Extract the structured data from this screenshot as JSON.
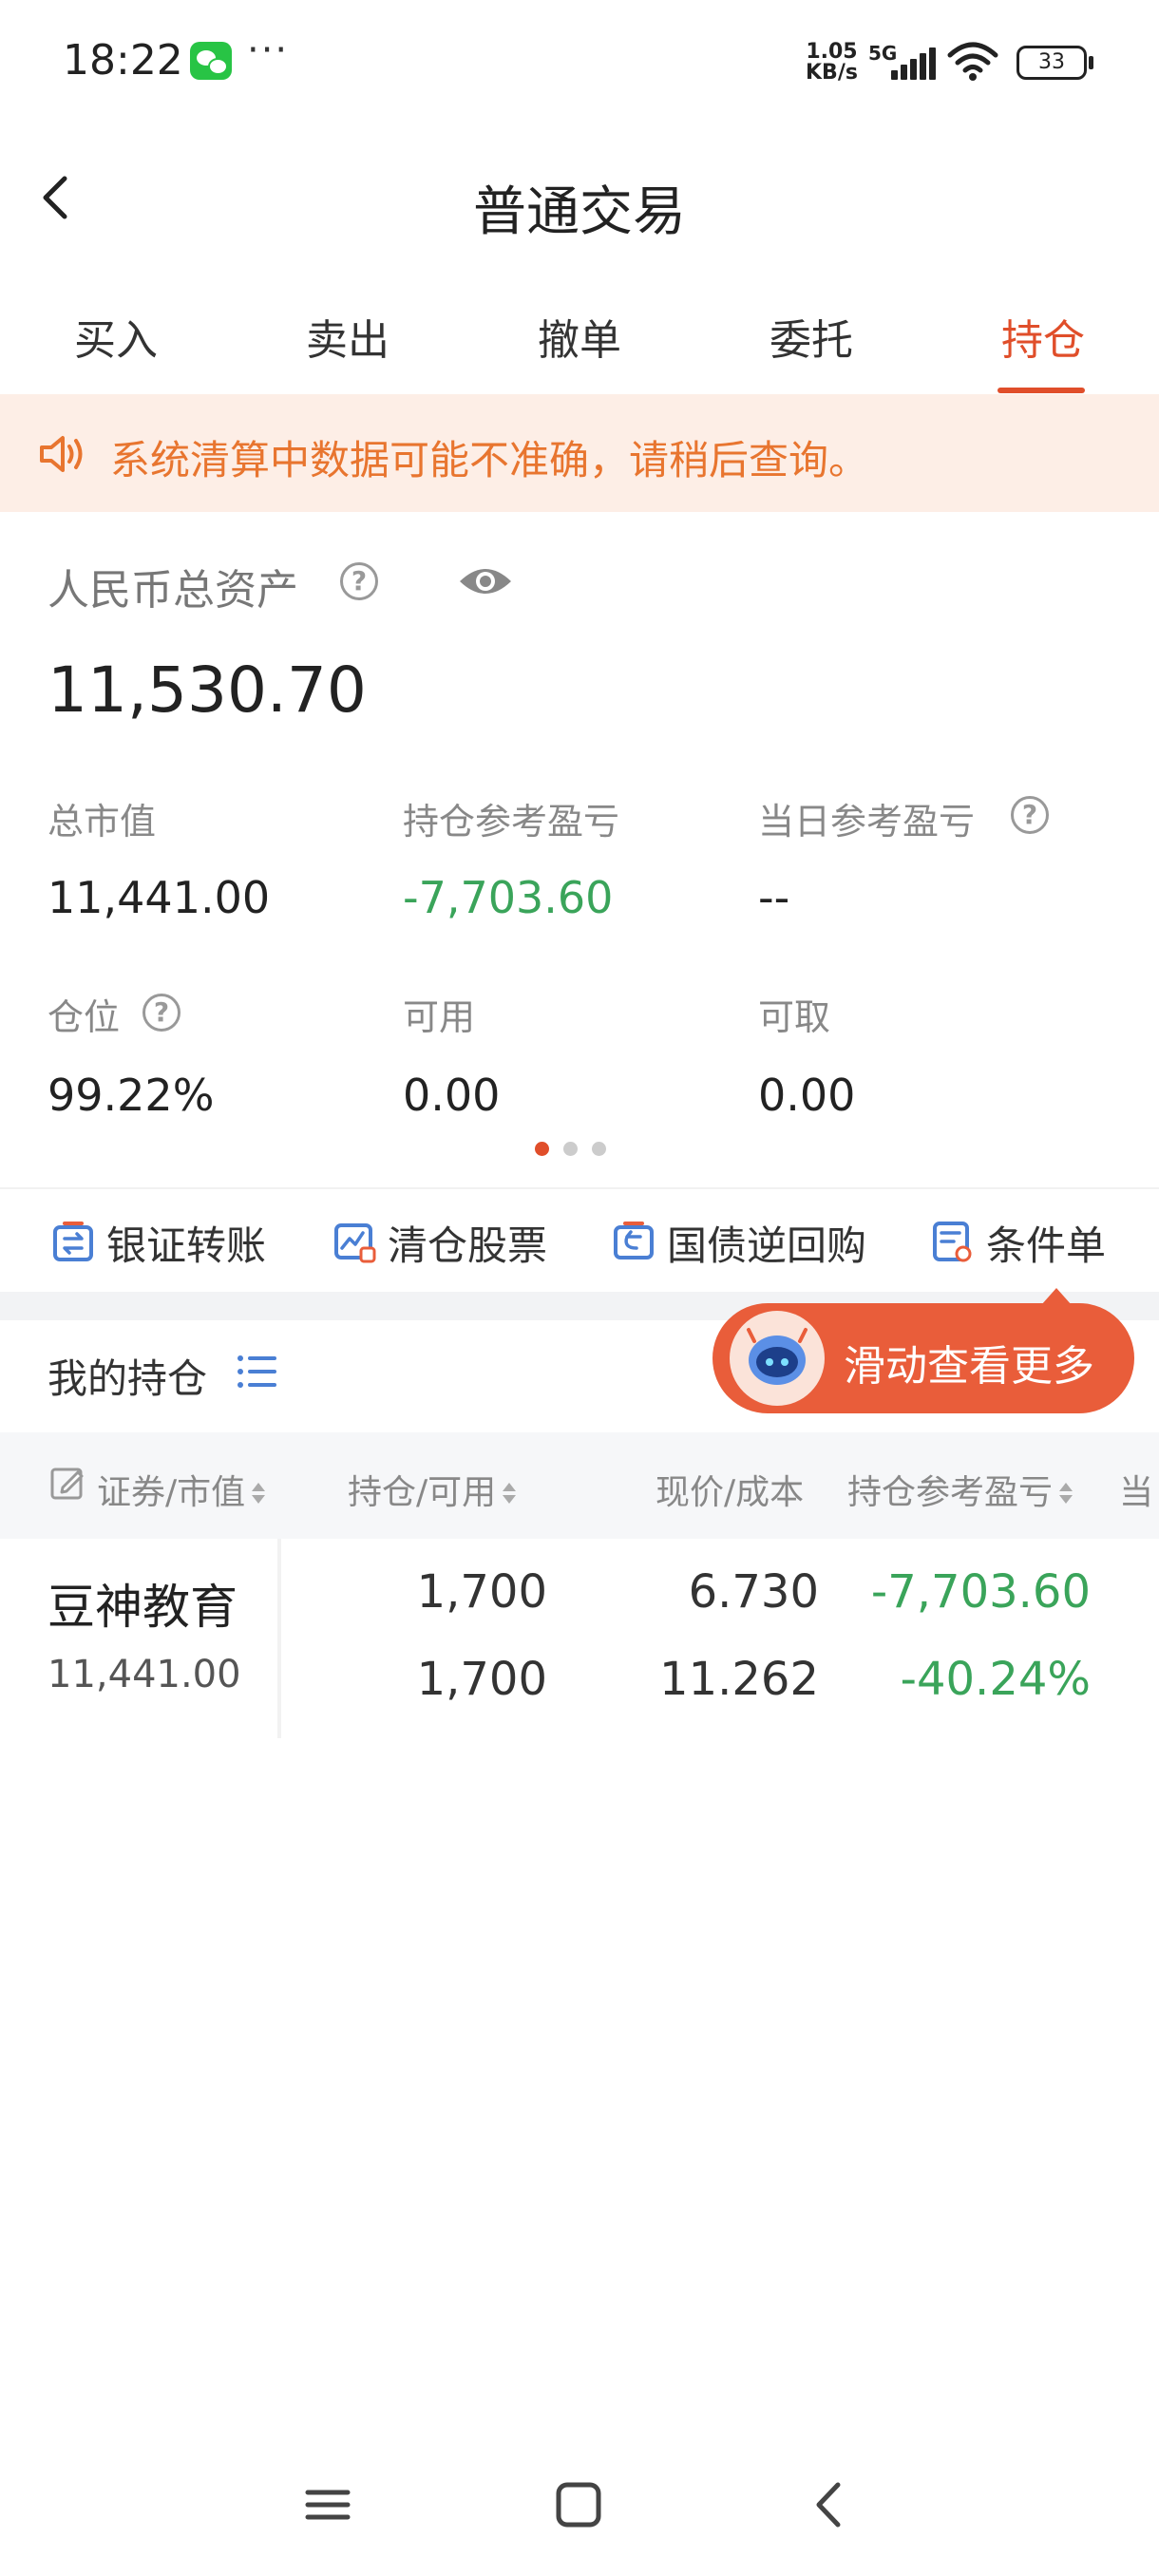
{
  "status_bar": {
    "time": "18:22",
    "more": "···",
    "net_speed_value": "1.05",
    "net_speed_unit": "KB/s",
    "network": "5G",
    "battery": "33"
  },
  "nav": {
    "title": "普通交易"
  },
  "tabs": [
    {
      "label": "买入"
    },
    {
      "label": "卖出"
    },
    {
      "label": "撤单"
    },
    {
      "label": "委托"
    },
    {
      "label": "持仓",
      "active": true
    }
  ],
  "notice": {
    "text": "系统清算中数据可能不准确，请稍后查询。"
  },
  "asset": {
    "label": "人民币总资产",
    "value": "11,530.70"
  },
  "metrics": {
    "total_market_value_label": "总市值",
    "total_market_value": "11,441.00",
    "position_pnl_label": "持仓参考盈亏",
    "position_pnl": "-7,703.60",
    "daily_pnl_label": "当日参考盈亏",
    "daily_pnl": "--",
    "position_ratio_label": "仓位",
    "position_ratio": "99.22%",
    "available_label": "可用",
    "available": "0.00",
    "withdrawable_label": "可取",
    "withdrawable": "0.00"
  },
  "quick_actions": [
    {
      "label": "银证转账",
      "icon": "bank-transfer-icon"
    },
    {
      "label": "清仓股票",
      "icon": "clear-position-icon"
    },
    {
      "label": "国债逆回购",
      "icon": "repo-icon"
    },
    {
      "label": "条件单",
      "icon": "condition-order-icon"
    }
  ],
  "holdings": {
    "title": "我的持仓",
    "scroll_hint": "滑动查看更多",
    "columns": [
      "证券/市值",
      "持仓/可用",
      "现价/成本",
      "持仓参考盈亏",
      "当日"
    ],
    "rows": [
      {
        "name": "豆神教育",
        "market_value": "11,441.00",
        "position": "1,700",
        "available": "1,700",
        "price": "6.730",
        "cost": "11.262",
        "pnl": "-7,703.60",
        "pnl_pct": "-40.24%"
      }
    ]
  },
  "colors": {
    "accent": "#e04e2a",
    "notice_bg": "#fdeee6",
    "notice_text": "#e8752f",
    "loss_green": "#3aa45a",
    "badge": "#e95d3a",
    "icon_blue": "#4a7fd4"
  }
}
